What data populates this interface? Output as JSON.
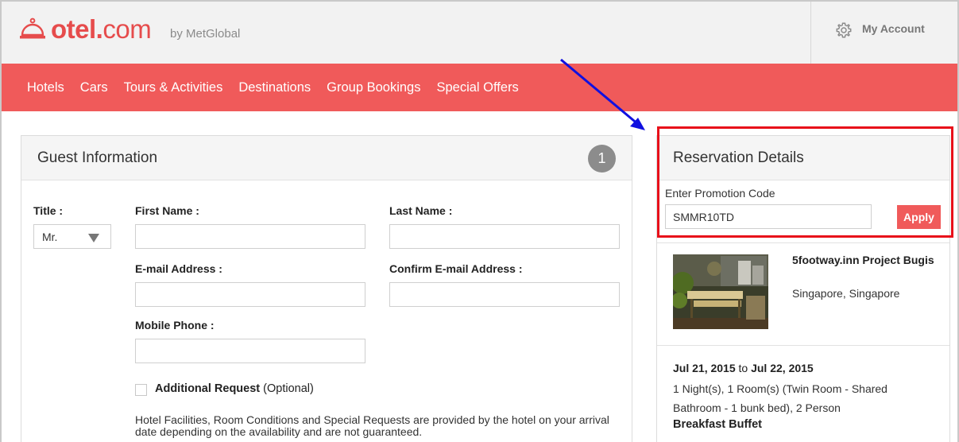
{
  "header": {
    "logo": {
      "word_light": "otel",
      "word_dot": ".",
      "word_tail": "com",
      "byline": "by MetGlobal",
      "icon": "hotel-bell-icon",
      "brand_color": "#e64c4c"
    },
    "account": {
      "label": "My Account",
      "icon": "gear-icon"
    }
  },
  "nav": {
    "background": "#f05a5a",
    "items": [
      {
        "label": "Hotels"
      },
      {
        "label": "Cars"
      },
      {
        "label": "Tours & Activities"
      },
      {
        "label": "Destinations"
      },
      {
        "label": "Group Bookings"
      },
      {
        "label": "Special Offers"
      }
    ]
  },
  "guest": {
    "title": "Guest Information",
    "step": "1",
    "fields": {
      "title_label": "Title :",
      "title_value": "Mr.",
      "first_name_label": "First Name :",
      "first_name_value": "",
      "last_name_label": "Last Name :",
      "last_name_value": "",
      "email_label": "E-mail Address :",
      "email_value": "",
      "confirm_email_label": "Confirm E-mail Address :",
      "confirm_email_value": "",
      "mobile_label": "Mobile Phone :",
      "mobile_value": ""
    },
    "additional_request": {
      "label": "Additional Request",
      "optional": "(Optional)",
      "checked": false
    },
    "disclaimer": "Hotel Facilities, Room Conditions and Special Requests are provided by the hotel on your arrival date depending on the availability and are not guaranteed."
  },
  "reservation": {
    "title": "Reservation Details",
    "promo": {
      "label": "Enter Promotion Code",
      "value": "SMMR10TD",
      "apply_label": "Apply"
    },
    "hotel": {
      "name": "5footway.inn Project Bugis",
      "location": "Singapore, Singapore"
    },
    "stay": {
      "check_in": "Jul 21, 2015",
      "to": "to",
      "check_out": "Jul 22, 2015",
      "description": "1 Night(s), 1 Room(s) (Twin Room - Shared Bathroom - 1 bunk bed), 2 Person",
      "meal": "Breakfast Buffet"
    }
  },
  "annotations": {
    "highlight_color": "#e8101a",
    "arrow_color": "#1010e0"
  }
}
